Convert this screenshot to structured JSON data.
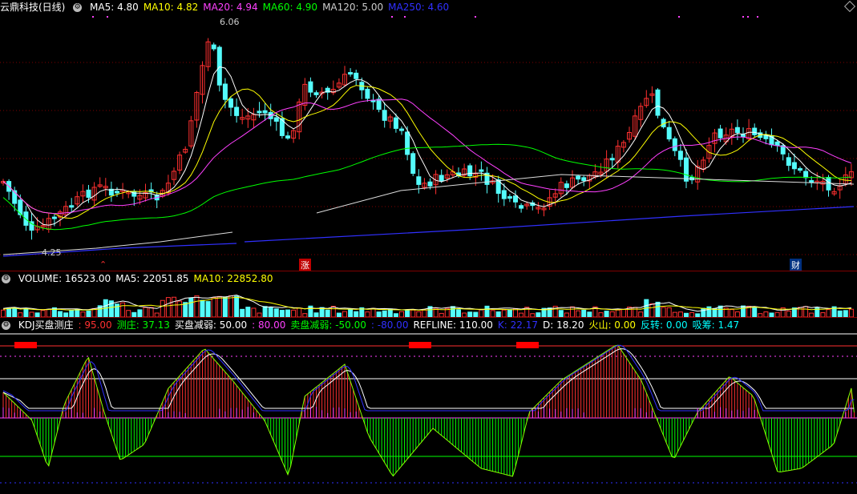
{
  "main": {
    "title": "云鼎科技(日线)",
    "ma_labels": [
      {
        "text": "MA5: 4.80",
        "color": "#ffffff"
      },
      {
        "text": "MA10: 4.82",
        "color": "#ffff00"
      },
      {
        "text": "MA20: 4.94",
        "color": "#ff40ff"
      },
      {
        "text": "MA60: 4.90",
        "color": "#00ff00"
      },
      {
        "text": "MA120: 5.00",
        "color": "#cccccc"
      },
      {
        "text": "MA250: 4.60",
        "color": "#3030ff"
      }
    ],
    "high_label": "6.06",
    "low_label": "4.25",
    "marker_zhang": "涨",
    "marker_cai": "财"
  },
  "volume": {
    "labels": [
      {
        "text": "VOLUME: 16523.00",
        "color": "#ffffff"
      },
      {
        "text": "MA5: 22051.85",
        "color": "#ffffff"
      },
      {
        "text": "MA10: 22852.80",
        "color": "#ffff00"
      }
    ]
  },
  "kdj": {
    "labels": [
      {
        "text": "KDJ买盘测庄",
        "color": "#ffffff"
      },
      {
        "text": ": 95.00",
        "color": "#ff3030"
      },
      {
        "text": "测庄: 37.13",
        "color": "#00ff00"
      },
      {
        "text": "买盘减弱: 50.00",
        "color": "#ffffff"
      },
      {
        "text": ": 80.00",
        "color": "#ff40ff"
      },
      {
        "text": "卖盘减弱: -50.00",
        "color": "#00ff00"
      },
      {
        "text": ": -80.00",
        "color": "#3030ff"
      },
      {
        "text": "REFLINE: 110.00",
        "color": "#ffffff"
      },
      {
        "text": "K: 22.17",
        "color": "#3030ff"
      },
      {
        "text": "D: 18.20",
        "color": "#ffffff"
      },
      {
        "text": "火山: 0.00",
        "color": "#ffff00"
      },
      {
        "text": "反转: 0.00",
        "color": "#00ffff"
      },
      {
        "text": "吸筹: 1.47",
        "color": "#00ffff"
      }
    ]
  },
  "colors": {
    "up": "#ff3030",
    "down": "#54fcfc",
    "bg": "#000000",
    "grid": "#800000"
  }
}
